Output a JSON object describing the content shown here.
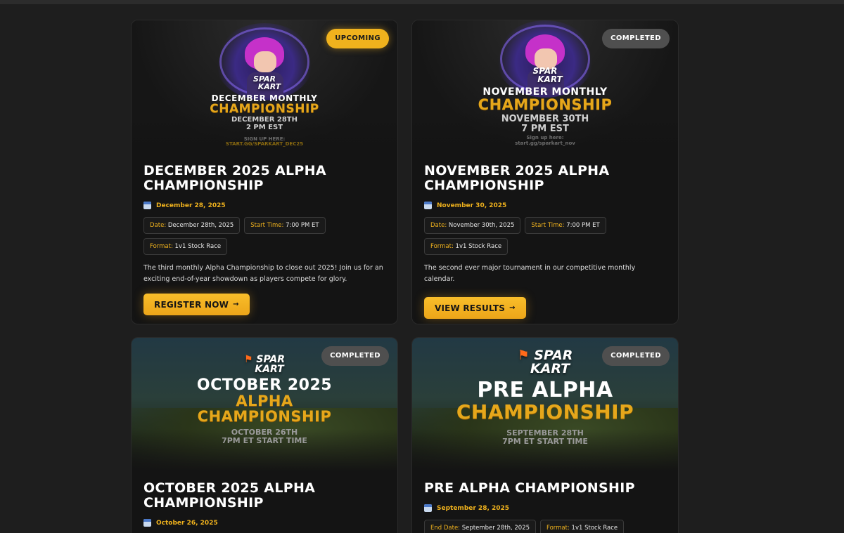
{
  "cards": [
    {
      "status": "UPCOMING",
      "banner": {
        "logo_line1": "SPAR",
        "logo_line2": "KART",
        "month_line": "DECEMBER MONTHLY",
        "champ_line": "CHAMPIONSHIP",
        "date_line": "DECEMBER 28TH",
        "time_line": "2 PM EST",
        "signup_label": "SIGN UP HERE:",
        "signup_url": "START.GG/SPARKART_DEC25"
      },
      "title": "DECEMBER 2025 ALPHA CHAMPIONSHIP",
      "date": "December 28, 2025",
      "chips": [
        {
          "key": "Date:",
          "value": "December 28th, 2025"
        },
        {
          "key": "Start Time:",
          "value": "7:00 PM ET"
        },
        {
          "key": "Format:",
          "value": "1v1 Stock Race"
        }
      ],
      "description": "The third monthly Alpha Championship to close out 2025! Join us for an exciting end-of-year showdown as players compete for glory.",
      "button": "REGISTER NOW",
      "button_arrow": "→"
    },
    {
      "status": "COMPLETED",
      "banner": {
        "logo_line1": "SPAR",
        "logo_line2": "KART",
        "month_line": "NOVEMBER MONTHLY",
        "champ_line": "CHAMPIONSHIP",
        "date_line": "NOVEMBER 30TH",
        "time_line": "7 PM EST",
        "signup_label": "Sign up here:",
        "signup_url": "start.gg/sparkart_nov"
      },
      "title": "NOVEMBER 2025 ALPHA CHAMPIONSHIP",
      "date": "November 30, 2025",
      "chips": [
        {
          "key": "Date:",
          "value": "November 30th, 2025"
        },
        {
          "key": "Start Time:",
          "value": "7:00 PM ET"
        },
        {
          "key": "Format:",
          "value": "1v1 Stock Race"
        }
      ],
      "description": "The second ever major tournament in our competitive monthly calendar.",
      "button": "VIEW RESULTS",
      "button_arrow": "→"
    },
    {
      "status": "COMPLETED",
      "banner": {
        "logo_line1": "SPAR",
        "logo_line2": "KART",
        "line1": "OCTOBER 2025",
        "line2": "ALPHA",
        "line3": "CHAMPIONSHIP",
        "date_line": "OCTOBER 26TH",
        "time_line": "7PM ET START TIME"
      },
      "title": "OCTOBER 2025 ALPHA CHAMPIONSHIP",
      "date": "October 26, 2025"
    },
    {
      "status": "COMPLETED",
      "banner": {
        "logo_line1": "SPAR",
        "logo_line2": "KART",
        "line1": "PRE ALPHA",
        "line2": "CHAMPIONSHIP",
        "date_line": "SEPTEMBER 28TH",
        "time_line": "7PM ET START TIME"
      },
      "title": "PRE ALPHA CHAMPIONSHIP",
      "date": "September 28, 2025",
      "chips": [
        {
          "key": "End Date:",
          "value": "September 28th, 2025"
        },
        {
          "key": "Format:",
          "value": "1v1 Stock Race"
        }
      ]
    }
  ]
}
